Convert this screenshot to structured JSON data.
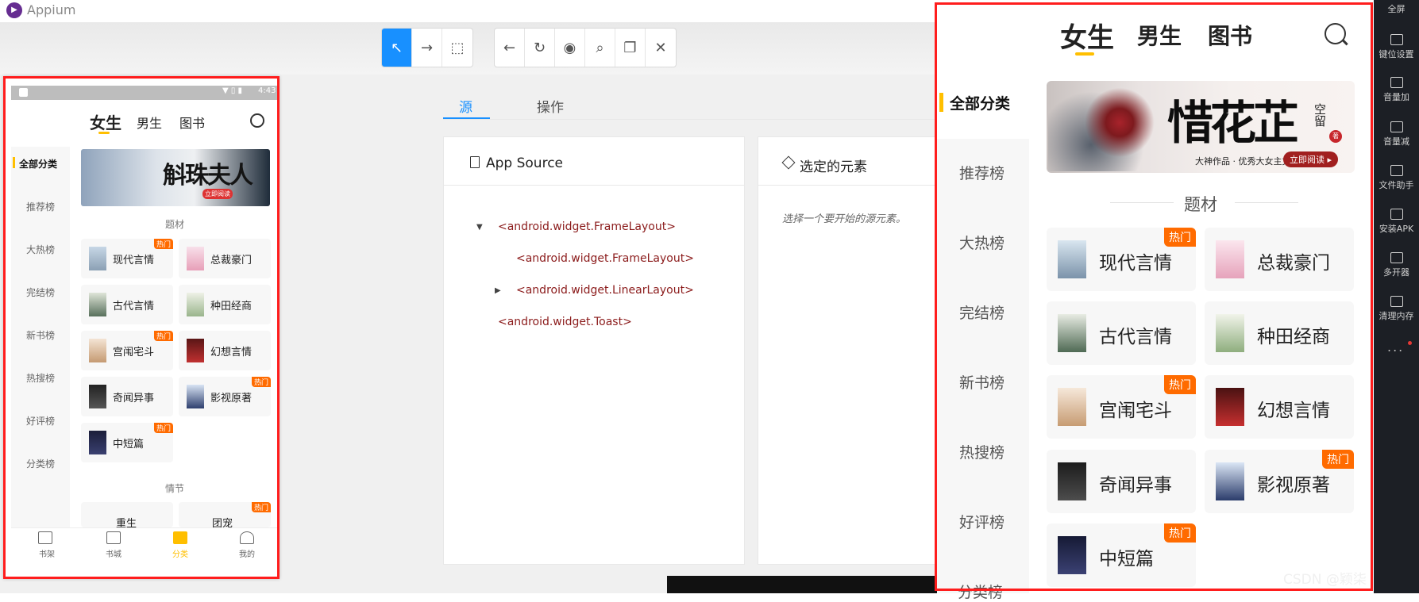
{
  "app": {
    "title": "Appium",
    "logo_glyph": "▶"
  },
  "toolbar": {
    "group1": [
      "select-icon",
      "swipe-icon",
      "tap-coordinates-icon"
    ],
    "group2": [
      "back-icon",
      "refresh-icon",
      "show-icon",
      "search-icon",
      "copy-icon",
      "close-icon"
    ],
    "glyphs1": [
      "↖",
      "→",
      "⬚"
    ],
    "glyphs2": [
      "←",
      "↻",
      "◉",
      "⌕",
      "❐",
      "✕"
    ],
    "accent_color": "#1890ff"
  },
  "left_phone": {
    "status_time": "4:43",
    "status_icons": "▼ ▯ ▮",
    "tabs": [
      "女生",
      "男生",
      "图书"
    ],
    "sidebar": [
      "全部分类",
      "推荐榜",
      "大热榜",
      "完结榜",
      "新书榜",
      "热搜榜",
      "好评榜",
      "分类榜"
    ],
    "banner_title": "斛珠夫人",
    "banner_button": "立即阅读",
    "section_topic": "题材",
    "section_plot": "情节",
    "categories": [
      "现代言情",
      "总裁豪门",
      "古代言情",
      "种田经商",
      "宫闱宅斗",
      "幻想言情",
      "奇闻异事",
      "影视原著",
      "中短篇"
    ],
    "plot_items": [
      "重生",
      "团宠"
    ],
    "hot_label": "热门",
    "bottom_nav": [
      "书架",
      "书城",
      "分类",
      "我的"
    ],
    "active_nav_color": "#ffbf00"
  },
  "inspector": {
    "tabs": [
      "源",
      "操作"
    ],
    "source_panel_title": "App Source",
    "selected_panel_title": "选定的元素",
    "selected_hint": "选择一个要开始的源元素。",
    "xml_nodes": [
      "<android.widget.FrameLayout>",
      "<android.widget.FrameLayout>",
      "<android.widget.LinearLayout>",
      "<android.widget.Toast>"
    ]
  },
  "mirror": {
    "tabs": [
      "女生",
      "男生",
      "图书"
    ],
    "sidebar": [
      "全部分类",
      "推荐榜",
      "大热榜",
      "完结榜",
      "新书榜",
      "热搜榜",
      "好评榜",
      "分类榜"
    ],
    "banner_title": "惜花芷",
    "banner_author": "空留",
    "banner_seal": "著",
    "banner_caption": "大神作品 · 优秀大女主文推荐",
    "banner_button": "立即阅读 ▸",
    "section_title": "题材",
    "categories": [
      "现代言情",
      "总裁豪门",
      "古代言情",
      "种田经商",
      "宫闱宅斗",
      "幻想言情",
      "奇闻异事",
      "影视原著",
      "中短篇"
    ],
    "hot_label": "热门",
    "accent_color": "#ffbf00",
    "hot_color": "#ff6b00"
  },
  "emulator_sidebar": [
    "全屏",
    "键位设置",
    "音量加",
    "音量减",
    "文件助手",
    "安装APK",
    "多开器",
    "清理内存"
  ],
  "emulator_more": "...",
  "watermark": "CSDN @颖柒"
}
